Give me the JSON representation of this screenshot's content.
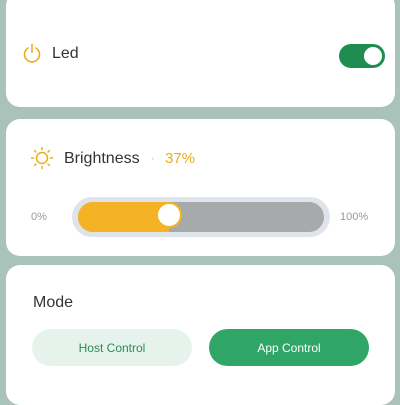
{
  "led": {
    "label": "Led",
    "enabled": true,
    "icon": "power-icon"
  },
  "brightness": {
    "label": "Brightness",
    "separator": "·",
    "value_text": "37%",
    "value": 37,
    "min_label": "0%",
    "max_label": "100%",
    "icon": "sun-icon"
  },
  "mode": {
    "label": "Mode",
    "options": [
      "Host Control",
      "App Control"
    ],
    "selected": "App Control"
  },
  "colors": {
    "background": "#a9c3ba",
    "accent_green": "#1e8d4f",
    "accent_yellow": "#f4b324",
    "slider_track": "#a7a9ab"
  }
}
